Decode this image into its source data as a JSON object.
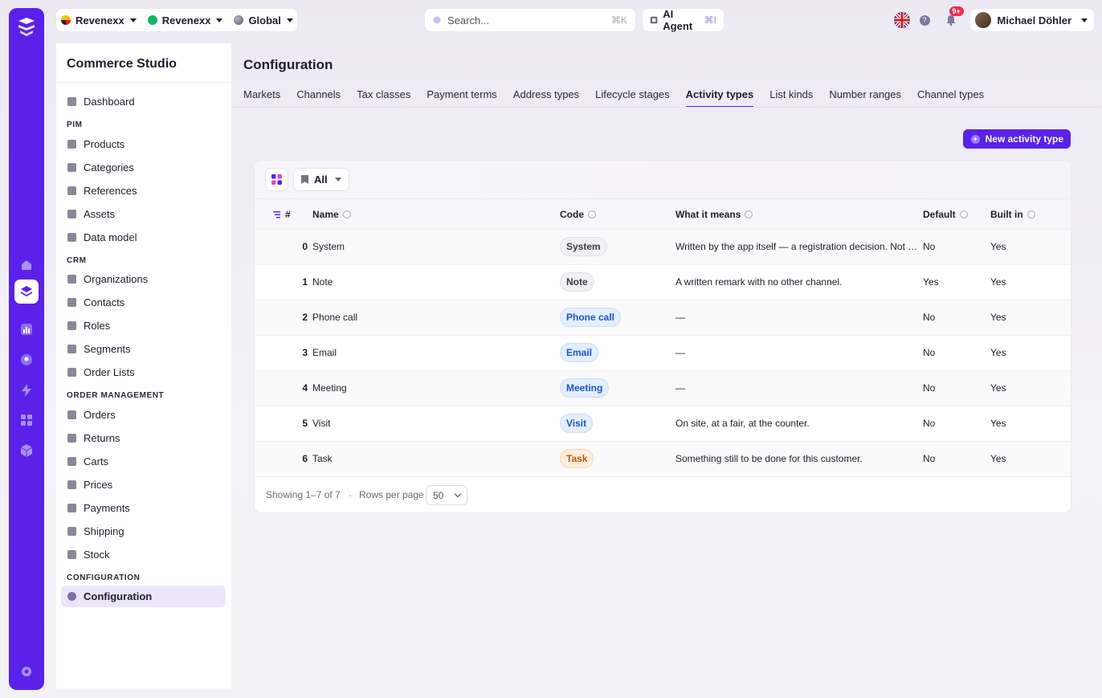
{
  "topbar": {
    "org1": "Revenexx",
    "org2": "Revenexx",
    "scope": "Global",
    "search_placeholder": "Search...",
    "search_shortcut": "⌘K",
    "ai_agent_label": "AI Agent",
    "ai_agent_shortcut": "⌘I",
    "notifications_badge": "9+",
    "user_name": "Michael Döhler",
    "help_glyph": "?"
  },
  "sidebar": {
    "title": "Commerce Studio",
    "dashboard": "Dashboard",
    "sections": {
      "pim": "PIM",
      "crm": "CRM",
      "order_management": "ORDER MANAGEMENT",
      "configuration": "CONFIGURATION"
    },
    "pim_items": [
      "Products",
      "Categories",
      "References",
      "Assets",
      "Data model"
    ],
    "crm_items": [
      "Organizations",
      "Contacts",
      "Roles",
      "Segments",
      "Order Lists"
    ],
    "om_items": [
      "Orders",
      "Returns",
      "Carts",
      "Prices",
      "Payments",
      "Shipping",
      "Stock"
    ],
    "config_items": [
      "Configuration"
    ]
  },
  "main": {
    "title": "Configuration",
    "tabs": [
      "Markets",
      "Channels",
      "Tax classes",
      "Payment terms",
      "Address types",
      "Lifecycle stages",
      "Activity types",
      "List kinds",
      "Number ranges",
      "Channel types"
    ],
    "active_tab": "Activity types",
    "new_button": "New activity type",
    "new_button_glyph": "+"
  },
  "table": {
    "filter_label": "All",
    "columns": {
      "index": "#",
      "name": "Name",
      "code": "Code",
      "meaning": "What it means",
      "default": "Default",
      "built_in": "Built in"
    },
    "rows": [
      {
        "index": "0",
        "name": "System",
        "code": "System",
        "code_color": "gray",
        "meaning": "Written by the app itself — a registration decision. Not …",
        "default": "No",
        "built_in": "Yes"
      },
      {
        "index": "1",
        "name": "Note",
        "code": "Note",
        "code_color": "gray",
        "meaning": "A written remark with no other channel.",
        "default": "Yes",
        "built_in": "Yes"
      },
      {
        "index": "2",
        "name": "Phone call",
        "code": "Phone call",
        "code_color": "blue",
        "meaning": "—",
        "default": "No",
        "built_in": "Yes"
      },
      {
        "index": "3",
        "name": "Email",
        "code": "Email",
        "code_color": "blue",
        "meaning": "—",
        "default": "No",
        "built_in": "Yes"
      },
      {
        "index": "4",
        "name": "Meeting",
        "code": "Meeting",
        "code_color": "blue",
        "meaning": "—",
        "default": "No",
        "built_in": "Yes"
      },
      {
        "index": "5",
        "name": "Visit",
        "code": "Visit",
        "code_color": "blue",
        "meaning": "On site, at a fair, at the counter.",
        "default": "No",
        "built_in": "Yes"
      },
      {
        "index": "6",
        "name": "Task",
        "code": "Task",
        "code_color": "orange",
        "meaning": "Something still to be done for this customer.",
        "default": "No",
        "built_in": "Yes"
      }
    ],
    "footer": {
      "showing": "Showing 1–7 of 7",
      "separator": "-",
      "rows_per_page_label": "Rows per page",
      "rows_per_page_value": "50"
    }
  },
  "colors": {
    "accent": "#5b21e8",
    "chip_blue": "#1c55c9",
    "chip_orange": "#b85c10",
    "badge": "#e8304d"
  }
}
